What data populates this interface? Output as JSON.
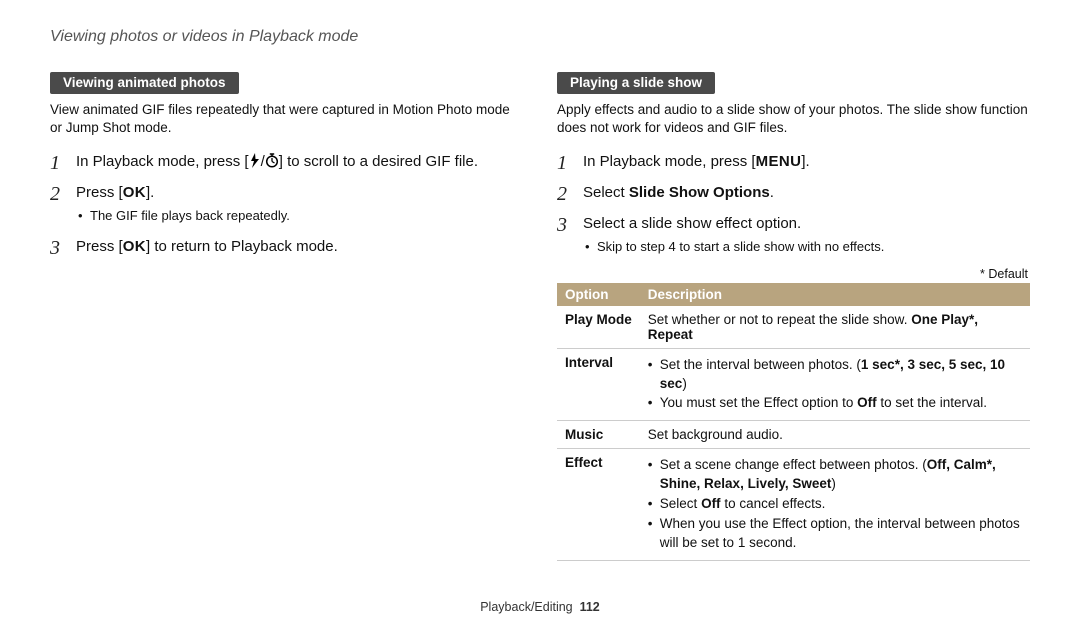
{
  "header": "Viewing photos or videos in Playback mode",
  "left": {
    "pill": "Viewing animated photos",
    "intro": "View animated GIF files repeatedly that were captured in Motion Photo mode or Jump Shot mode.",
    "step1_a": "In Playback mode, press [",
    "step1_b": "/",
    "step1_c": "] to scroll to a desired GIF file.",
    "step2_a": "Press [",
    "step2_b": "].",
    "step2_sub": "The GIF file plays back repeatedly.",
    "step3_a": "Press [",
    "step3_b": "] to return to Playback mode.",
    "ok_label": "OK"
  },
  "right": {
    "pill": "Playing a slide show",
    "intro": "Apply effects and audio to a slide show of your photos. The slide show function does not work for videos and GIF files.",
    "step1_a": "In Playback mode, press [",
    "step1_b": "].",
    "menu_label": "MENU",
    "step2_a": "Select ",
    "step2_b": "Slide Show Options",
    "step2_c": ".",
    "step3": "Select a slide show effect option.",
    "step3_sub": "Skip to step 4 to start a slide show with no effects.",
    "default": "* Default",
    "th_option": "Option",
    "th_desc": "Description",
    "rows": {
      "playmode": {
        "label": "Play Mode",
        "pre": "Set whether or not to repeat the slide show. ",
        "opts": "One Play*, Repeat"
      },
      "interval": {
        "label": "Interval",
        "b1a": "Set the interval between photos. (",
        "b1b": "1 sec*, 3 sec, 5 sec, 10 sec",
        "b1c": ")",
        "b2a": "You must set the Effect option to ",
        "b2b": "Off",
        "b2c": " to set the interval."
      },
      "music": {
        "label": "Music",
        "text": "Set background audio."
      },
      "effect": {
        "label": "Effect",
        "b1a": "Set a scene change effect between photos. (",
        "b1b": "Off, Calm*, Shine, Relax, Lively, Sweet",
        "b1c": ")",
        "b2a": "Select ",
        "b2b": "Off",
        "b2c": " to cancel effects.",
        "b3": "When you use the Effect option, the interval between photos will be set to 1 second."
      }
    }
  },
  "footer": {
    "section": "Playback/Editing",
    "page": "112"
  }
}
